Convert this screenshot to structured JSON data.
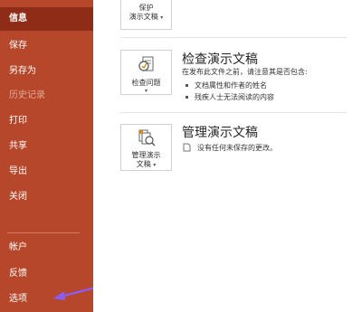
{
  "sidebar": {
    "items": [
      {
        "label": "信息",
        "state": "active"
      },
      {
        "label": "保存",
        "state": "normal"
      },
      {
        "label": "另存为",
        "state": "normal"
      },
      {
        "label": "历史记录",
        "state": "disabled"
      },
      {
        "label": "打印",
        "state": "normal"
      },
      {
        "label": "共享",
        "state": "normal"
      },
      {
        "label": "导出",
        "state": "normal"
      },
      {
        "label": "关闭",
        "state": "normal"
      }
    ],
    "bottom_items": [
      {
        "label": "帐户"
      },
      {
        "label": "反馈"
      },
      {
        "label": "选项"
      }
    ]
  },
  "protect": {
    "button_line1": "保护",
    "button_line2": "演示文稿"
  },
  "inspect": {
    "button_label": "检查问题",
    "title": "检查演示文稿",
    "description": "在发布此文件之前，请注意其是否包含:",
    "bullets": [
      "文档属性和作者的姓名",
      "残疾人士无法阅读的内容"
    ]
  },
  "manage": {
    "button_line1": "管理演示",
    "button_line2": "文稿",
    "title": "管理演示文稿",
    "description": "没有任何未保存的更改。"
  },
  "colors": {
    "sidebar_bg": "#b7472a",
    "sidebar_active": "#8f2c17",
    "arrow": "#8b5cf6"
  }
}
